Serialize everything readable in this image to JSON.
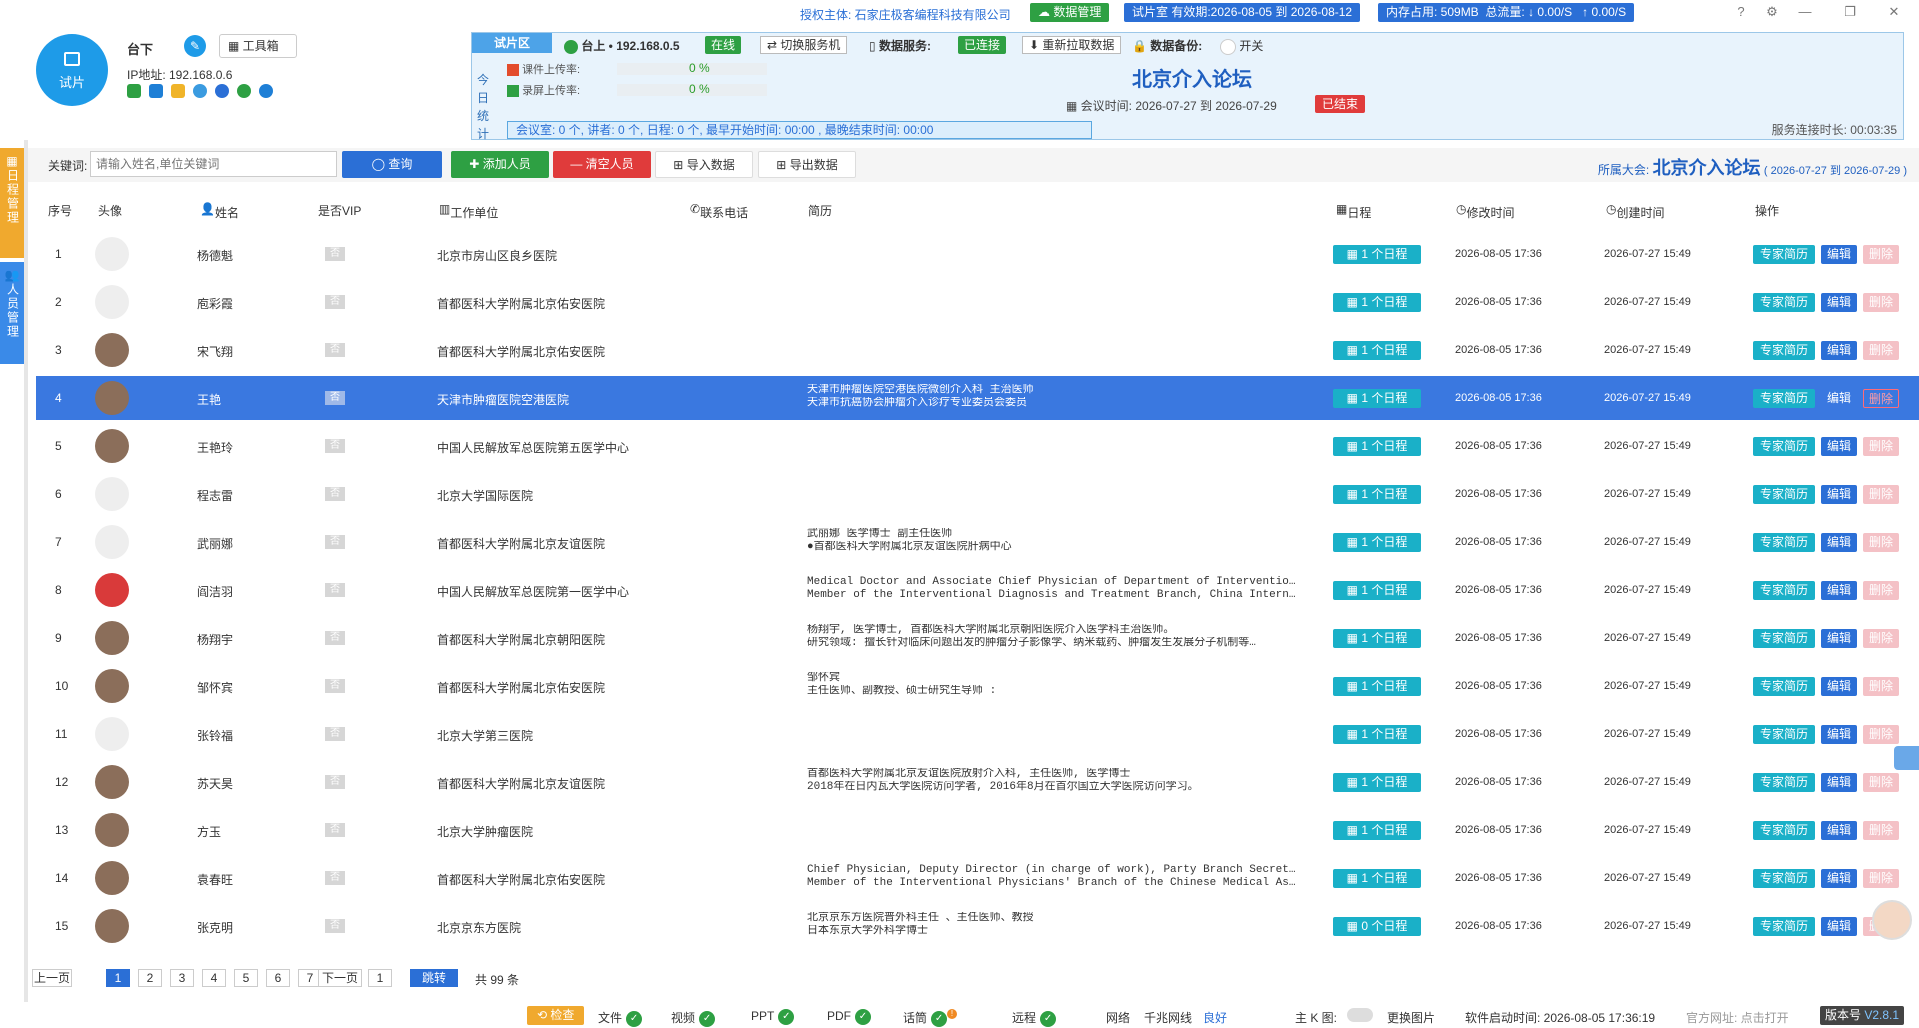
{
  "topbar": {
    "auth_label": "授权主体: 石家庄极客编程科技有限公司",
    "data_mgmt": "数据管理",
    "validity": "试片室 有效期:2026-08-05 到 2026-08-12",
    "memory": "内存占用: 509MB",
    "traffic_label": "总流量:",
    "down": "↓ 0.00/S",
    "up": "↑ 0.00/S"
  },
  "room": {
    "badge_text": "试片",
    "name": "台下",
    "toolbox": "工具箱",
    "ip": "IP地址: 192.168.0.6"
  },
  "panel": {
    "tab": "试片区",
    "host": "台上 • 192.168.0.5",
    "online": "在线",
    "switch_service": "切换服务机",
    "data_service_label": "数据服务:",
    "connected": "已连接",
    "repull": "重新拉取数据",
    "backup_label": "数据备份:",
    "switch_label": "开关",
    "vertical_label": [
      "今",
      "日",
      "统",
      "计"
    ],
    "upload_ppt_label": "课件上传率:",
    "upload_ppt_value": "0 %",
    "upload_rec_label": "录屏上传率:",
    "upload_rec_value": "0 %",
    "stats": "会议室: 0 个,  讲者: 0 个,  日程: 0 个,  最早开始时间: 00:00 ,     最晚结束时间: 00:00",
    "forum_title": "北京介入论坛",
    "meeting_time": "会议时间:  2026-07-27  到  2026-07-29",
    "ended": "已结束",
    "uptime": "服务连接时长: 00:03:35"
  },
  "sidetabs": [
    "日程管理",
    "人员管理"
  ],
  "search": {
    "label": "关键词:",
    "placeholder": "请输入姓名,单位关键词",
    "query": "查询",
    "add": "添加人员",
    "clear": "清空人员",
    "import": "导入数据",
    "export": "导出数据",
    "belong_label": "所属大会:",
    "belong_name": "北京介入论坛",
    "belong_dates": "( 2026-07-27 到 2026-07-29 )"
  },
  "table": {
    "headers": {
      "seq": "序号",
      "avatar": "头像",
      "name": "姓名",
      "vip": "是否VIP",
      "unit": "工作单位",
      "phone": "联系电话",
      "bio": "简历",
      "schedule": "日程",
      "modified": "修改时间",
      "created": "创建时间",
      "ops": "操作"
    },
    "action_labels": {
      "expert": "专家简历",
      "edit": "编辑",
      "delete": "删除"
    },
    "rows": [
      {
        "seq": "1",
        "name": "杨德魁",
        "vip": "否",
        "unit": "北京市房山区良乡医院",
        "bio1": "",
        "bio2": "",
        "schedule": "1 个日程",
        "modified": "2026-08-05 17:36",
        "created": "2026-07-27 15:49",
        "avatar": "placeholder"
      },
      {
        "seq": "2",
        "name": "庖彩霞",
        "vip": "否",
        "unit": "首都医科大学附属北京佑安医院",
        "bio1": "",
        "bio2": "",
        "schedule": "1 个日程",
        "modified": "2026-08-05 17:36",
        "created": "2026-07-27 15:49",
        "avatar": "placeholder"
      },
      {
        "seq": "3",
        "name": "宋飞翔",
        "vip": "否",
        "unit": "首都医科大学附属北京佑安医院",
        "bio1": "",
        "bio2": "",
        "schedule": "1 个日程",
        "modified": "2026-08-05 17:36",
        "created": "2026-07-27 15:49",
        "avatar": "photo"
      },
      {
        "seq": "4",
        "name": "王艳",
        "vip": "否",
        "unit": "天津市肿瘤医院空港医院",
        "bio1": "天津市肿瘤医院空港医院微创介入科 主治医师",
        "bio2": "天津市抗癌协会肿瘤介入诊疗专业委员会委员",
        "schedule": "1 个日程",
        "modified": "2026-08-05 17:36",
        "created": "2026-07-27 15:49",
        "avatar": "photo",
        "selected": true
      },
      {
        "seq": "5",
        "name": "王艳玲",
        "vip": "否",
        "unit": "中国人民解放军总医院第五医学中心",
        "bio1": "",
        "bio2": "",
        "schedule": "1 个日程",
        "modified": "2026-08-05 17:36",
        "created": "2026-07-27 15:49",
        "avatar": "photo"
      },
      {
        "seq": "6",
        "name": "程志雷",
        "vip": "否",
        "unit": "北京大学国际医院",
        "bio1": "",
        "bio2": "",
        "schedule": "1 个日程",
        "modified": "2026-08-05 17:36",
        "created": "2026-07-27 15:49",
        "avatar": "placeholder"
      },
      {
        "seq": "7",
        "name": "武丽娜",
        "vip": "否",
        "unit": "首都医科大学附属北京友谊医院",
        "bio1": "武丽娜 医学博士 副主任医师",
        "bio2": "●首都医科大学附属北京友谊医院肝病中心",
        "schedule": "1 个日程",
        "modified": "2026-08-05 17:36",
        "created": "2026-07-27 15:49",
        "avatar": "placeholder"
      },
      {
        "seq": "8",
        "name": "阎洁羽",
        "vip": "否",
        "unit": "中国人民解放军总医院第一医学中心",
        "bio1": "Medical Doctor and Associate Chief Physician of Department of Interventional Radi…",
        "bio2": "Member of the Interventional Diagnosis and Treatment Branch, China International…",
        "schedule": "1 个日程",
        "modified": "2026-08-05 17:36",
        "created": "2026-07-27 15:49",
        "avatar": "photo-red"
      },
      {
        "seq": "9",
        "name": "杨翔宇",
        "vip": "否",
        "unit": "首都医科大学附属北京朝阳医院",
        "bio1": "杨翔宇, 医学博士, 首都医科大学附属北京朝阳医院介入医学科主治医师。",
        "bio2": "研究领域: 擅长针对临床问题出发的肿瘤分子影像学、纳米载药、肿瘤发生发展分子机制等…",
        "schedule": "1 个日程",
        "modified": "2026-08-05 17:36",
        "created": "2026-07-27 15:49",
        "avatar": "photo"
      },
      {
        "seq": "10",
        "name": "邹怀宾",
        "vip": "否",
        "unit": "首都医科大学附属北京佑安医院",
        "bio1": "邹怀宾",
        "bio2": "主任医师、副教授、硕士研究生导师 :",
        "schedule": "1 个日程",
        "modified": "2026-08-05 17:36",
        "created": "2026-07-27 15:49",
        "avatar": "photo"
      },
      {
        "seq": "11",
        "name": "张铃福",
        "vip": "否",
        "unit": "北京大学第三医院",
        "bio1": "",
        "bio2": "",
        "schedule": "1 个日程",
        "modified": "2026-08-05 17:36",
        "created": "2026-07-27 15:49",
        "avatar": "placeholder"
      },
      {
        "seq": "12",
        "name": "苏天昊",
        "vip": "否",
        "unit": "首都医科大学附属北京友谊医院",
        "bio1": "首都医科大学附属北京友谊医院放射介入科, 主任医师, 医学博士",
        "bio2": "2018年在日内瓦大学医院访问学者, 2016年8月在首尔国立大学医院访问学习。",
        "schedule": "1 个日程",
        "modified": "2026-08-05 17:36",
        "created": "2026-07-27 15:49",
        "avatar": "photo"
      },
      {
        "seq": "13",
        "name": "方玉",
        "vip": "否",
        "unit": "北京大学肿瘤医院",
        "bio1": "",
        "bio2": "",
        "schedule": "1 个日程",
        "modified": "2026-08-05 17:36",
        "created": "2026-07-27 15:49",
        "avatar": "photo"
      },
      {
        "seq": "14",
        "name": "袁春旺",
        "vip": "否",
        "unit": "首都医科大学附属北京佑安医院",
        "bio1": "Chief Physician, Deputy Director (in charge of work), Party Branch Secretary of I…",
        "bio2": "Member of the Interventional Physicians' Branch of the Chinese Medical Association",
        "schedule": "1 个日程",
        "modified": "2026-08-05 17:36",
        "created": "2026-07-27 15:49",
        "avatar": "photo"
      },
      {
        "seq": "15",
        "name": "张克明",
        "vip": "否",
        "unit": "北京京东方医院",
        "bio1": "北京京东方医院普外科主任 、主任医师、教授",
        "bio2": "日本东京大学外科学博士",
        "schedule": "0 个日程",
        "modified": "2026-08-05 17:36",
        "created": "2026-07-27 15:49",
        "avatar": "photo"
      }
    ]
  },
  "pager": {
    "prev": "上一页",
    "pages": [
      "1",
      "2",
      "3",
      "4",
      "5",
      "6",
      "7"
    ],
    "next": "下一页",
    "jump_value": "1",
    "jump": "跳转",
    "total": "共 99 条"
  },
  "statusbar": {
    "check": "检查",
    "file": "文件",
    "video": "视频",
    "ppt": "PPT",
    "pdf": "PDF",
    "speech": "话筒",
    "remote": "远程",
    "network": "网络",
    "gigabit": "千兆网线",
    "good": "良好",
    "k_screen": "主 K 图:",
    "change_image": "更换图片",
    "start_time": "软件启动时间: 2026-08-05 17:36:19",
    "website": "官方网址: 点击打开",
    "version_label": "版本号",
    "version": "V2.8.1"
  },
  "colors": {
    "accent": "#1e9be8",
    "selected_row": "#3a78e0",
    "teal": "#1ab0c8",
    "danger": "#e03b3b",
    "success": "#2ea043"
  }
}
